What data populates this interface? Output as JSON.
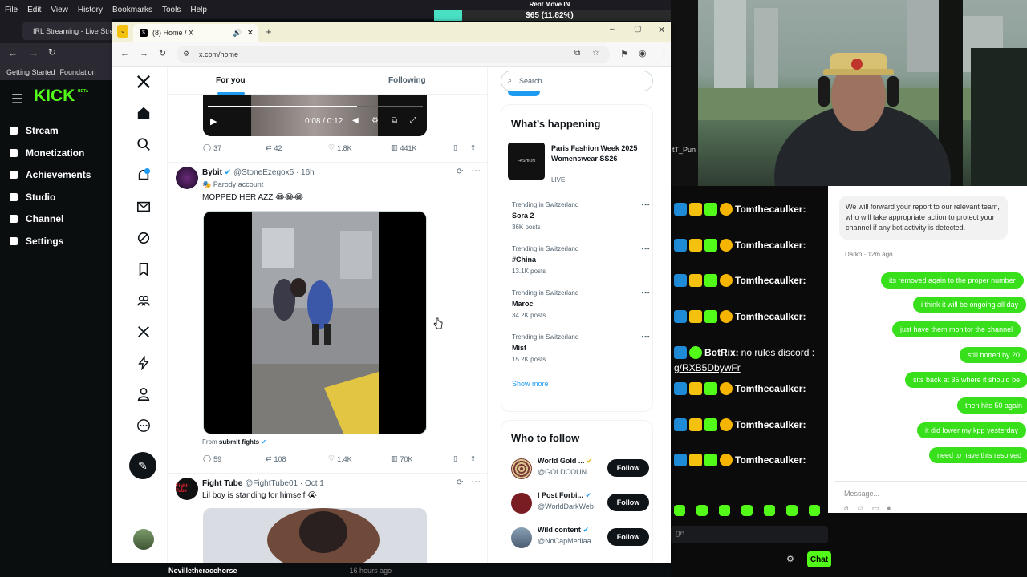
{
  "bg_browser": {
    "menu": [
      "File",
      "Edit",
      "View",
      "History",
      "Bookmarks",
      "Tools",
      "Help"
    ],
    "tab_title": "IRL Streaming - Live Stre",
    "bookmarks": [
      "Getting Started",
      "Foundation"
    ]
  },
  "kick": {
    "logo": "KICK",
    "logo_tag": "BETA",
    "nav": [
      "Stream",
      "Monetization",
      "Achievements",
      "Studio",
      "Channel",
      "Settings"
    ]
  },
  "goal": {
    "title": "Rent Move IN",
    "amount": "$65 (11.82%)",
    "progress": 0.1182
  },
  "chat": {
    "lines": [
      {
        "user": "Tomthecaulker:",
        "text": ""
      },
      {
        "user": "Tomthecaulker:",
        "text": ""
      },
      {
        "user": "Tomthecaulker:",
        "text": ""
      },
      {
        "user": "Tomthecaulker:",
        "text": ""
      },
      {
        "user": "BotRix:",
        "text": "no rules discord :"
      },
      {
        "user": "Tomthecaulker:",
        "text": ""
      },
      {
        "user": "Tomthecaulker:",
        "text": ""
      },
      {
        "user": "Tomthecaulker:",
        "text": ""
      }
    ],
    "link": "g/RXB5DbywFr",
    "partial_user": "tT_Pun",
    "input_placeholder": "ge",
    "chat_button": "Chat",
    "bottom_user": "Nevilletheracehorse",
    "bottom_time": "16 hours ago"
  },
  "support": {
    "incoming": "We will forward your report to our relevant team, who will take appropriate action to protect your channel if any bot activity is detected.",
    "agent": "Darko",
    "agent_time": "12m ago",
    "outgoing": [
      "its removed again to the proper number",
      "i think it will be ongoing all day",
      "just have them monitor the channel",
      "still botted by 20",
      "sits back at 35 where it should be",
      "then hits 50 again",
      "it did lower my kpp yesterday",
      "need to have this resolved"
    ],
    "input_placeholder": "Message..."
  },
  "x_browser": {
    "tab_title": "(8) Home / X",
    "url": "x.com/home"
  },
  "x": {
    "tabs": {
      "for_you": "For you",
      "following": "Following"
    },
    "video1": {
      "time": "0:08 / 0:12"
    },
    "post1_actions": {
      "replies": "37",
      "reposts": "42",
      "likes": "1.8K",
      "views": "441K"
    },
    "post2": {
      "name": "Bybit",
      "handle": "@StoneEzegox5",
      "time": "· 16h",
      "label": "Parody account",
      "text": "MOPPED HER AZZ 😂😂😂",
      "from_label": "From",
      "from_name": "submit fights",
      "actions": {
        "replies": "59",
        "reposts": "108",
        "likes": "1.4K",
        "views": "70K"
      }
    },
    "post3": {
      "name": "Fight Tube",
      "handle": "@FightTube01",
      "time": "· Oct 1",
      "text": "Lil boy is standing for himself 😭",
      "avatar_text": "Fight Tube"
    },
    "search_placeholder": "Search",
    "whats_happening": {
      "title": "What’s happening",
      "event": {
        "name": "Paris Fashion Week 2025 Womenswear SS26",
        "status": "LIVE",
        "thumb_text": "FASHION"
      },
      "trends": [
        {
          "context": "Trending in Switzerland",
          "name": "Sora 2",
          "posts": "36K posts"
        },
        {
          "context": "Trending in Switzerland",
          "name": "#China",
          "posts": "13.1K posts"
        },
        {
          "context": "Trending in Switzerland",
          "name": "Maroc",
          "posts": "34.2K posts"
        },
        {
          "context": "Trending in Switzerland",
          "name": "Mist",
          "posts": "15.2K posts"
        }
      ],
      "show_more": "Show more"
    },
    "who_to_follow": {
      "title": "Who to follow",
      "accounts": [
        {
          "name": "World Gold ...",
          "handle": "@GOLDCOUN...",
          "button": "Follow"
        },
        {
          "name": "I Post Forbi...",
          "handle": "@WorldDarkWeb",
          "button": "Follow"
        },
        {
          "name": "Wild content",
          "handle": "@NoCapMediaa",
          "button": "Follow"
        }
      ]
    }
  },
  "colors": {
    "kick_green": "#53fc18",
    "x_blue": "#1d9bf0",
    "x_black": "#0f1419",
    "support_green": "#37e01a"
  }
}
